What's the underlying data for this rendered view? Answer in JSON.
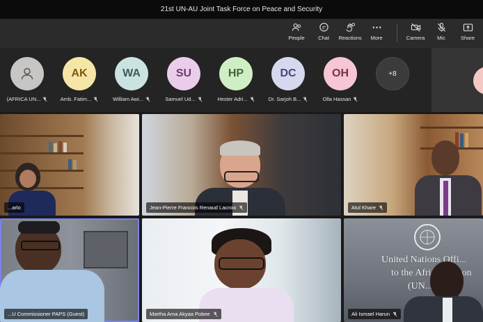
{
  "window": {
    "title": "21st UN-AU Joint Task Force on Peace and Security"
  },
  "toolbar": {
    "left": [
      {
        "label": "People",
        "icon": "people-icon"
      },
      {
        "label": "Chat",
        "icon": "chat-icon"
      },
      {
        "label": "Reactions",
        "icon": "reactions-icon"
      },
      {
        "label": "More",
        "icon": "more-icon"
      }
    ],
    "right": [
      {
        "label": "Camera",
        "icon": "camera-off-icon"
      },
      {
        "label": "Mic",
        "icon": "mic-off-icon"
      },
      {
        "label": "Share",
        "icon": "share-icon"
      }
    ]
  },
  "roster": {
    "participants": [
      {
        "initials": "",
        "name": "(AFRICA UN...",
        "color": "#c8c6c4",
        "icon": "person-icon"
      },
      {
        "initials": "AK",
        "name": "Amb. Fatim...",
        "color": "#f5e6a8"
      },
      {
        "initials": "WA",
        "name": "William Awi...",
        "color": "#cbe3e0"
      },
      {
        "initials": "SU",
        "name": "Samuel Ud...",
        "color": "#eacdeb"
      },
      {
        "initials": "HP",
        "name": "Hester Adri...",
        "color": "#cfeec5"
      },
      {
        "initials": "DC",
        "name": "Dr. Sarjoh B...",
        "color": "#d6d8ee"
      },
      {
        "initials": "OH",
        "name": "Olla Hassan",
        "color": "#f6c6d4"
      }
    ],
    "overflow": "+8"
  },
  "videos": [
    {
      "name": "...arlo"
    },
    {
      "name": "Jean-Pierre Francois Renaud Lacroix"
    },
    {
      "name": "Atul Khare"
    },
    {
      "name": "...U Commissioner PAPS (Guest)"
    },
    {
      "name": "Martha Ama Akyaa Pobee"
    },
    {
      "name": "Ali Ismael Harun"
    }
  ],
  "un_backdrop": {
    "line1": "United Nations Offi...",
    "line2": "to the African Union",
    "line3": "(UN..."
  }
}
